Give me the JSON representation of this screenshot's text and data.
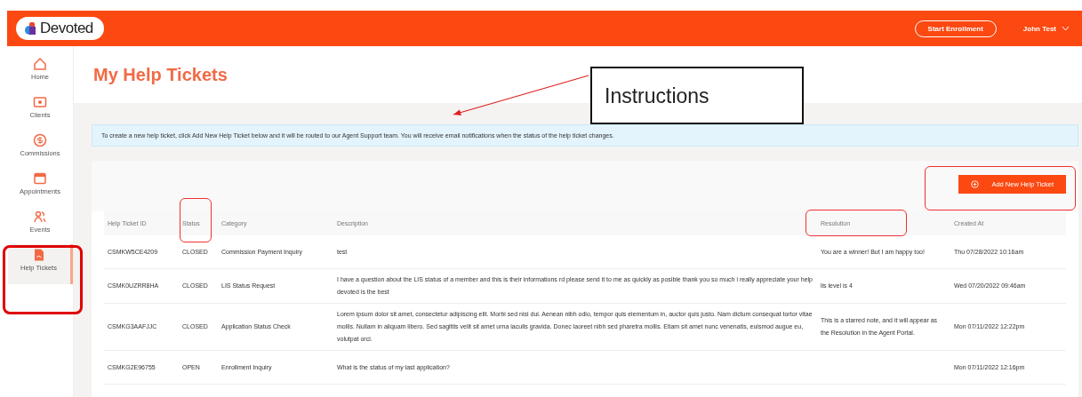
{
  "header": {
    "logo": "Devoted",
    "start_button": "Start Enrollment",
    "user": "John Test"
  },
  "sidebar": {
    "items": [
      {
        "kind": "home",
        "label": "Home",
        "selected": false
      },
      {
        "kind": "clients",
        "label": "Clients",
        "selected": false
      },
      {
        "kind": "commissions",
        "label": "Commissions",
        "selected": false
      },
      {
        "kind": "appointments",
        "label": "Appointments",
        "selected": false
      },
      {
        "kind": "events",
        "label": "Events",
        "selected": false
      },
      {
        "kind": "tickets",
        "label": "Help Tickets",
        "selected": true
      }
    ]
  },
  "page_title": "My Help Tickets",
  "info_banner": "To create a new help ticket, click Add New Help Ticket below and it will be routed to our Agent Support team. You will receive email notifications when the status of the help ticket changes.",
  "add_button": "Add New Help Ticket",
  "table": {
    "columns": [
      "Help Ticket ID",
      "Status",
      "Category",
      "Description",
      "Resolution",
      "Created At"
    ],
    "rows": [
      [
        "CSMKW5CE4209",
        "CLOSED",
        "Commission Payment Inquiry",
        "test",
        "You are a winner! But I am happy too!",
        "Thu 07/28/2022 10:16am"
      ],
      [
        "CSMK0UZRR8HA",
        "CLOSED",
        "LIS Status Request",
        "I have a question about the LIS status of a member and this is their informations rd please send it to me as quickly as posible thank you so much i really appreciate your help devoted is the best",
        "lis level is 4",
        "Wed 07/20/2022 09:46am"
      ],
      [
        "CSMKG3AAFJJC",
        "CLOSED",
        "Application Status Check",
        "Lorem ipsum dolor sit amet, consectetur adipiscing elit. Morbi sed nisi dui. Aenean nibh odio, tempor quis elementum in, auctor quis justo. Nam dictum consequat tortor vitae mollis. Nullam in aliquam libero. Sed sagittis velit sit amet urna iaculis gravida. Donec laoreet nibh sed pharetra mollis. Etiam sit amet nunc venenatis, euismod augue eu, volutpat orci.",
        "This is a starred note, and it will appear as the Resolution in the Agent Portal.",
        "Mon 07/11/2022 12:22pm"
      ],
      [
        "CSMKG2E96755",
        "OPEN",
        "Enrollment Inquiry",
        "What is the status of my last application?",
        "",
        "Mon 07/11/2022 12:16pm"
      ]
    ]
  },
  "callout": "Instructions"
}
